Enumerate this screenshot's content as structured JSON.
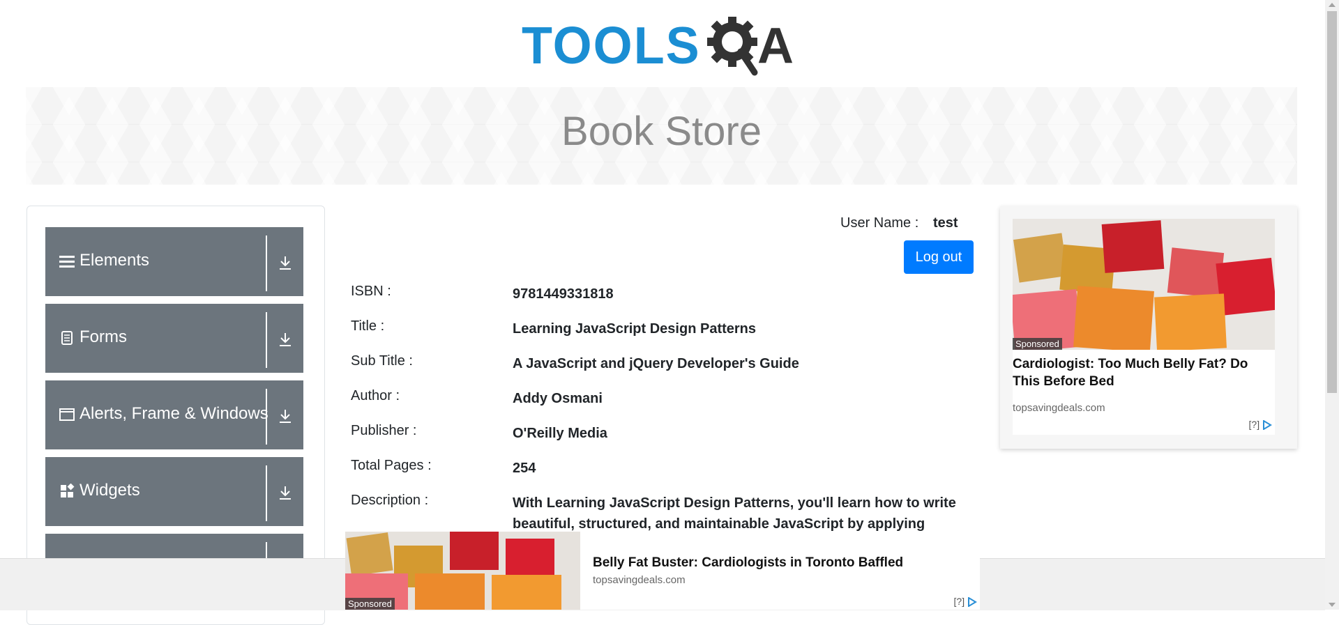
{
  "brand": {
    "logo_part1": "TOOLS",
    "logo_part2": "A"
  },
  "banner": {
    "title": "Book Store"
  },
  "nav": {
    "groups": [
      {
        "label": "Elements",
        "icon": "hamburger-icon"
      },
      {
        "label": "Forms",
        "icon": "document-icon"
      },
      {
        "label": "Alerts, Frame & Windows",
        "icon": "window-icon"
      },
      {
        "label": "Widgets",
        "icon": "widgets-icon"
      },
      {
        "label": "",
        "icon": ""
      }
    ]
  },
  "user": {
    "label": "User Name :",
    "name": "test",
    "logout_label": "Log out"
  },
  "book": {
    "fields": [
      {
        "label": "ISBN :",
        "value": "9781449331818"
      },
      {
        "label": "Title :",
        "value": "Learning JavaScript Design Patterns"
      },
      {
        "label": "Sub Title :",
        "value": "A JavaScript and jQuery Developer's Guide"
      },
      {
        "label": "Author :",
        "value": "Addy Osmani"
      },
      {
        "label": "Publisher :",
        "value": "O'Reilly Media"
      },
      {
        "label": "Total Pages :",
        "value": "254"
      },
      {
        "label": "Description :",
        "value": "With Learning JavaScript Design Patterns, you'll learn how to write beautiful, structured, and maintainable JavaScript by applying classical"
      }
    ]
  },
  "ads": {
    "right": {
      "sponsored": "Sponsored",
      "title": "Cardiologist: Too Much Belly Fat? Do This Before Bed",
      "domain": "topsavingdeals.com",
      "info": "[?]"
    },
    "bottom": {
      "sponsored": "Sponsored",
      "title": "Belly Fat Buster: Cardiologists in Toronto Baffled",
      "domain": "topsavingdeals.com",
      "info": "[?]"
    }
  },
  "colors": {
    "nav_bg": "#6c757d",
    "primary": "#007bff",
    "logo_blue": "#1b8ed3",
    "logo_dark": "#333333"
  }
}
